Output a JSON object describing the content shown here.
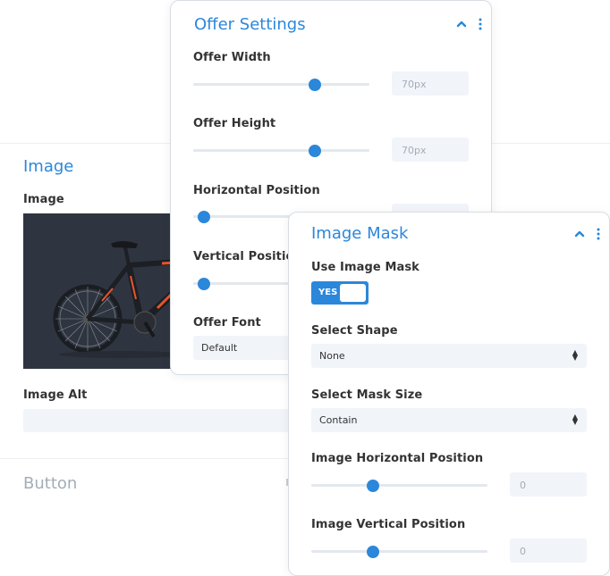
{
  "back": {
    "image_section_title": "Image",
    "image_label": "Image",
    "image_alt_label": "Image Alt",
    "button_section_title": "Button"
  },
  "offer": {
    "title": "Offer Settings",
    "width_label": "Offer Width",
    "width_value": "70px",
    "width_level": 0.69,
    "height_label": "Offer Height",
    "height_value": "70px",
    "height_level": 0.69,
    "hpos_label": "Horizontal Position",
    "hpos_level": 0.06,
    "vpos_label": "Vertical Position",
    "vpos_level": 0.06,
    "font_label": "Offer Font",
    "font_value": "Default"
  },
  "mask": {
    "title": "Image Mask",
    "use_label": "Use Image Mask",
    "toggle_label": "YES",
    "shape_label": "Select Shape",
    "shape_value": "None",
    "size_label": "Select Mask Size",
    "size_value": "Contain",
    "img_h_label": "Image Horizontal Position",
    "img_h_value": "0",
    "img_h_level": 0.35,
    "img_v_label": "Image Vertical Position",
    "img_v_value": "0",
    "img_v_level": 0.35
  },
  "colors": {
    "accent": "#2b87da",
    "input_bg": "#f1f4f9",
    "muted": "#a3adb8"
  }
}
